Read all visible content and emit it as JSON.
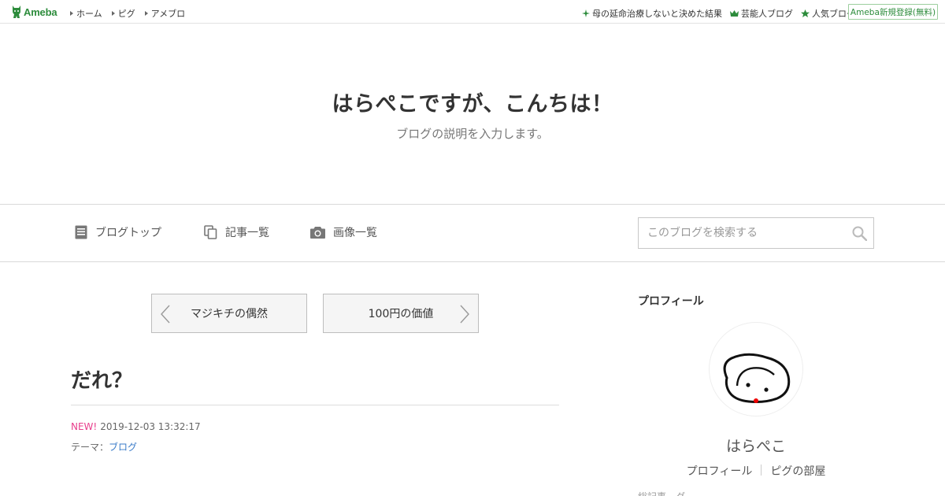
{
  "topbar": {
    "logo_text": "Ameba",
    "nav": [
      {
        "label": "ホーム"
      },
      {
        "label": "ピグ"
      },
      {
        "label": "アメブロ"
      }
    ],
    "right_links": [
      {
        "label": "母の延命治療しないと決めた結果",
        "icon": "sparkle-icon"
      },
      {
        "label": "芸能人ブログ",
        "icon": "crown-icon"
      },
      {
        "label": "人気ブログ",
        "icon": "star-icon"
      }
    ],
    "register_label": "Ameba新規登録(無料)"
  },
  "header": {
    "title": "はらぺこですが、こんちは！",
    "description": "ブログの説明を入力します。"
  },
  "gnav": {
    "items": [
      {
        "label": "ブログトップ",
        "icon": "document-icon"
      },
      {
        "label": "記事一覧",
        "icon": "copy-icon"
      },
      {
        "label": "画像一覧",
        "icon": "camera-icon"
      }
    ],
    "search_placeholder": "このブログを検索する"
  },
  "pager": {
    "prev_label": "マジキチの偶然",
    "next_label": "100円の価値"
  },
  "article": {
    "title": "だれ？",
    "new_label": "NEW!",
    "datetime": "2019-12-03 13:32:17",
    "theme_prefix": "テーマ：",
    "theme": "ブログ"
  },
  "sidebar": {
    "heading": "プロフィール",
    "name": "はらぺこ",
    "links": [
      "プロフィール",
      "ピグの部屋"
    ],
    "cut_text": "総記事…グ"
  },
  "colors": {
    "brand_green": "#2d8c3c",
    "new_pink": "#e83e8c",
    "link_blue": "#3a7bc8"
  }
}
